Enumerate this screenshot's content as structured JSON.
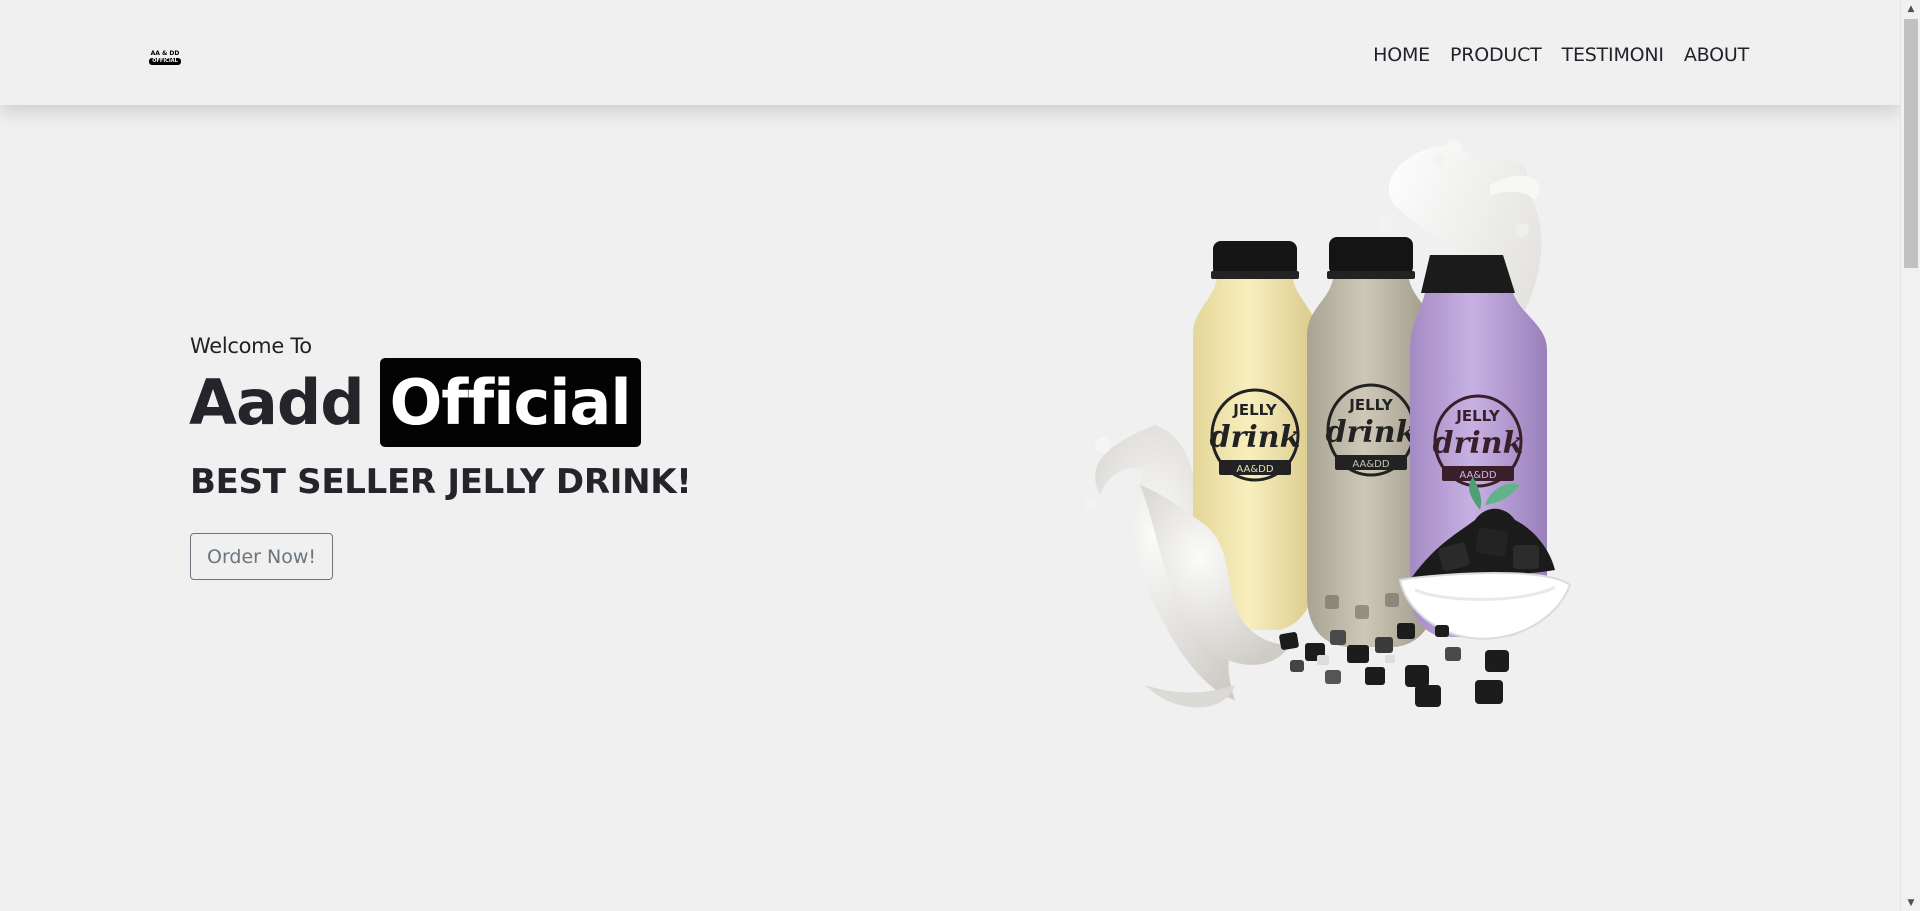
{
  "navbar": {
    "logo": {
      "line1": "AA & DD",
      "line2": "OFFICIAL"
    },
    "links": [
      "HOME",
      "PRODUCT",
      "TESTIMONI",
      "ABOUT"
    ]
  },
  "hero": {
    "welcome": "Welcome To",
    "brand_plain": "Aadd",
    "brand_highlight": "Official",
    "tagline": "BEST SELLER JELLY DRINK!",
    "cta": "Order Now!",
    "product_image": {
      "bottle_label_top": "JELLY",
      "bottle_label_script": "drink",
      "bottle_label_brand": "AA&DD",
      "flavors": [
        {
          "color": "#f2e6a8"
        },
        {
          "color": "#bdb7a6"
        },
        {
          "color": "#b9a1d8"
        }
      ]
    }
  },
  "colors": {
    "background": "#f0f0f0",
    "text_dark": "#23252b",
    "highlight_bg": "#030303",
    "button_outline": "#6c757d"
  },
  "icons": [
    "scroll-up-arrow-icon",
    "scroll-down-arrow-icon"
  ]
}
